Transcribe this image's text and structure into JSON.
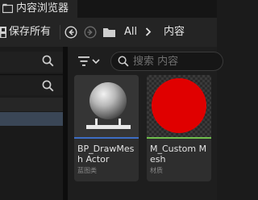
{
  "window": {
    "tab_title": "内容浏览器"
  },
  "toolbar": {
    "save_all_label": "保存所有",
    "breadcrumb_all": "All",
    "breadcrumb_content": "内容"
  },
  "search": {
    "placeholder": "搜索 内容"
  },
  "assets": [
    {
      "name": "BP_DrawMesh Actor",
      "type": "蓝图类",
      "bar_color": "#3d6dc4"
    },
    {
      "name": "M_Custom Mesh",
      "type": "材质",
      "bar_color": "#6fbf4c"
    }
  ],
  "colors": {
    "material_preview": "#e00000",
    "selected_row": "#3a4656"
  }
}
